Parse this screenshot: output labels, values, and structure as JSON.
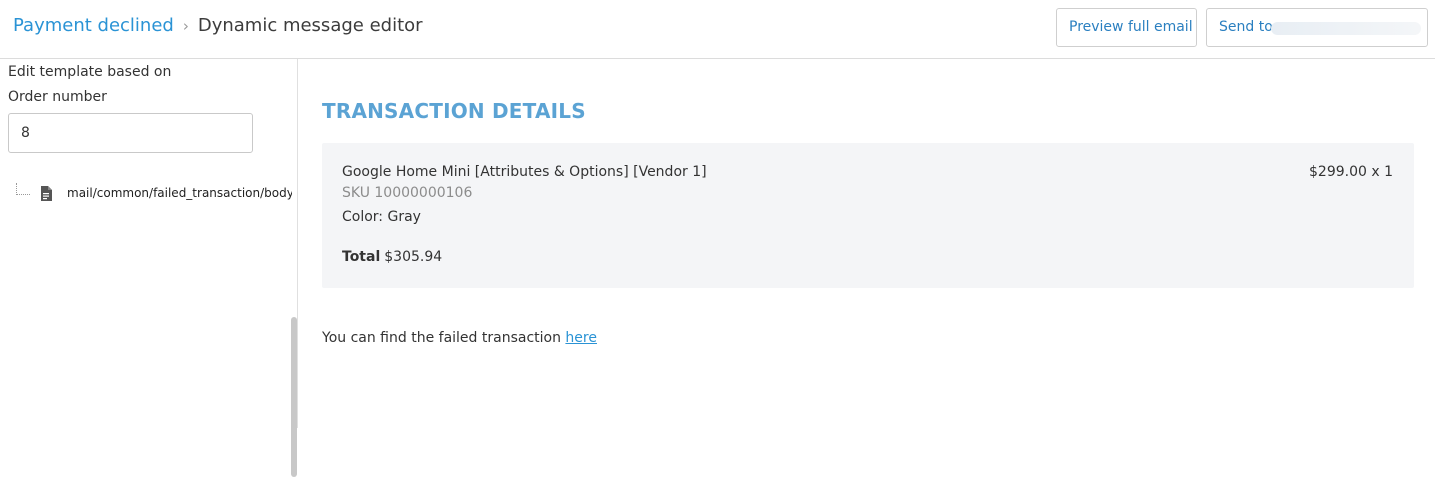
{
  "header": {
    "breadcrumb_parent": "Payment declined",
    "breadcrumb_separator": "›",
    "breadcrumb_current": "Dynamic message editor",
    "preview_button": "Preview full email",
    "send_button": "Send to"
  },
  "sidebar": {
    "template_label": "Edit template based on",
    "order_label": "Order number",
    "order_value": "8",
    "tree_file": "mail/common/failed_transaction/body.twig"
  },
  "content": {
    "section_title": "TRANSACTION DETAILS",
    "item": {
      "name": "Google Home Mini [Attributes & Options] [Vendor 1]",
      "sku": "SKU 10000000106",
      "color": "Color: Gray",
      "price": "$299.00 x 1",
      "total_label": "Total",
      "total_value": "$305.94"
    },
    "footer_text": "You can find the failed transaction",
    "footer_link": "here"
  },
  "icons": {
    "file": "file-icon"
  },
  "colors": {
    "link": "#2a93d5",
    "title": "#5ba3d4",
    "panel_bg": "#f4f5f7"
  }
}
